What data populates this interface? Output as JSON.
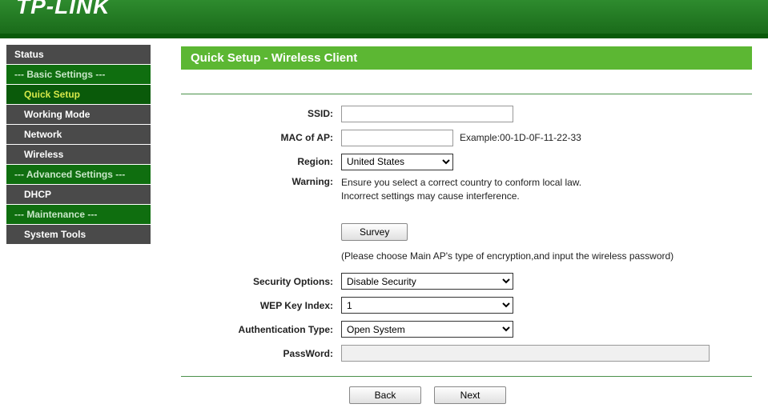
{
  "brand": "TP-LINK",
  "sidebar": {
    "status": "Status",
    "basic_header": "--- Basic Settings ---",
    "quick_setup": "Quick Setup",
    "working_mode": "Working Mode",
    "network": "Network",
    "wireless": "Wireless",
    "advanced_header": "--- Advanced Settings ---",
    "dhcp": "DHCP",
    "maintenance_header": "--- Maintenance ---",
    "system_tools": "System Tools"
  },
  "main": {
    "title": "Quick Setup - Wireless Client",
    "labels": {
      "ssid": "SSID:",
      "mac": "MAC of AP:",
      "region": "Region:",
      "warning": "Warning:",
      "security": "Security Options:",
      "wep_index": "WEP Key Index:",
      "auth_type": "Authentication Type:",
      "password": "PassWord:"
    },
    "values": {
      "ssid": "",
      "mac": "",
      "mac_example": "Example:00-1D-0F-11-22-33",
      "region_selected": "United States",
      "warning_line1": "Ensure you select a correct country to conform local law.",
      "warning_line2": "Incorrect settings may cause interference.",
      "security_selected": "Disable Security",
      "wep_selected": "1",
      "auth_selected": "Open System",
      "password": ""
    },
    "buttons": {
      "survey": "Survey",
      "back": "Back",
      "next": "Next"
    },
    "note": "(Please choose Main AP's type of encryption,and input the wireless password)"
  }
}
